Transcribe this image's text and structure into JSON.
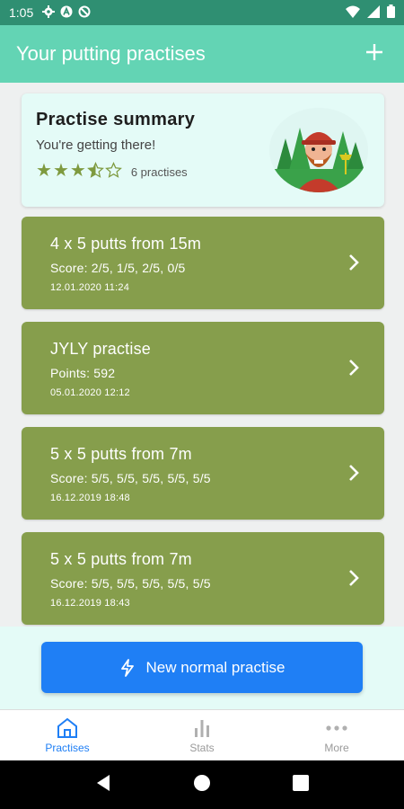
{
  "status_bar": {
    "time": "1:05",
    "left_icons": [
      "gear-icon",
      "a-badge-icon",
      "no-sync-icon"
    ],
    "right_icons": [
      "wifi-icon",
      "cell-signal-icon",
      "battery-icon"
    ],
    "bar_color": "#2f8f72"
  },
  "app_bar": {
    "title": "Your putting practises",
    "add_icon": "plus-icon",
    "color": "#63d4b4"
  },
  "summary": {
    "title": "Practise summary",
    "subtitle": "You're getting there!",
    "rating": 3.5,
    "rating_max": 5,
    "count_label": "6 practises",
    "star_color": "#7e9a3f"
  },
  "practises": [
    {
      "title": "4 x 5 putts from 15m",
      "detail": "Score: 2/5, 1/5, 2/5, 0/5",
      "date": "12.01.2020 11:24"
    },
    {
      "title": "JYLY practise",
      "detail": "Points: 592",
      "date": "05.01.2020 12:12"
    },
    {
      "title": "5 x 5 putts from 7m",
      "detail": "Score: 5/5, 5/5, 5/5, 5/5, 5/5",
      "date": "16.12.2019 18:48"
    },
    {
      "title": "5 x 5 putts from 7m",
      "detail": "Score: 5/5, 5/5, 5/5, 5/5, 5/5",
      "date": "16.12.2019 18:43"
    }
  ],
  "card_color": "#869e4c",
  "cta": {
    "label": "New normal practise",
    "icon": "lightning-icon",
    "color": "#1f7ff5"
  },
  "bottom_nav": [
    {
      "label": "Practises",
      "icon": "home-icon",
      "active": true
    },
    {
      "label": "Stats",
      "icon": "bar-chart-icon",
      "active": false
    },
    {
      "label": "More",
      "icon": "more-dots-icon",
      "active": false
    }
  ],
  "system_nav": [
    "back-icon",
    "home-circle-icon",
    "recents-icon"
  ]
}
